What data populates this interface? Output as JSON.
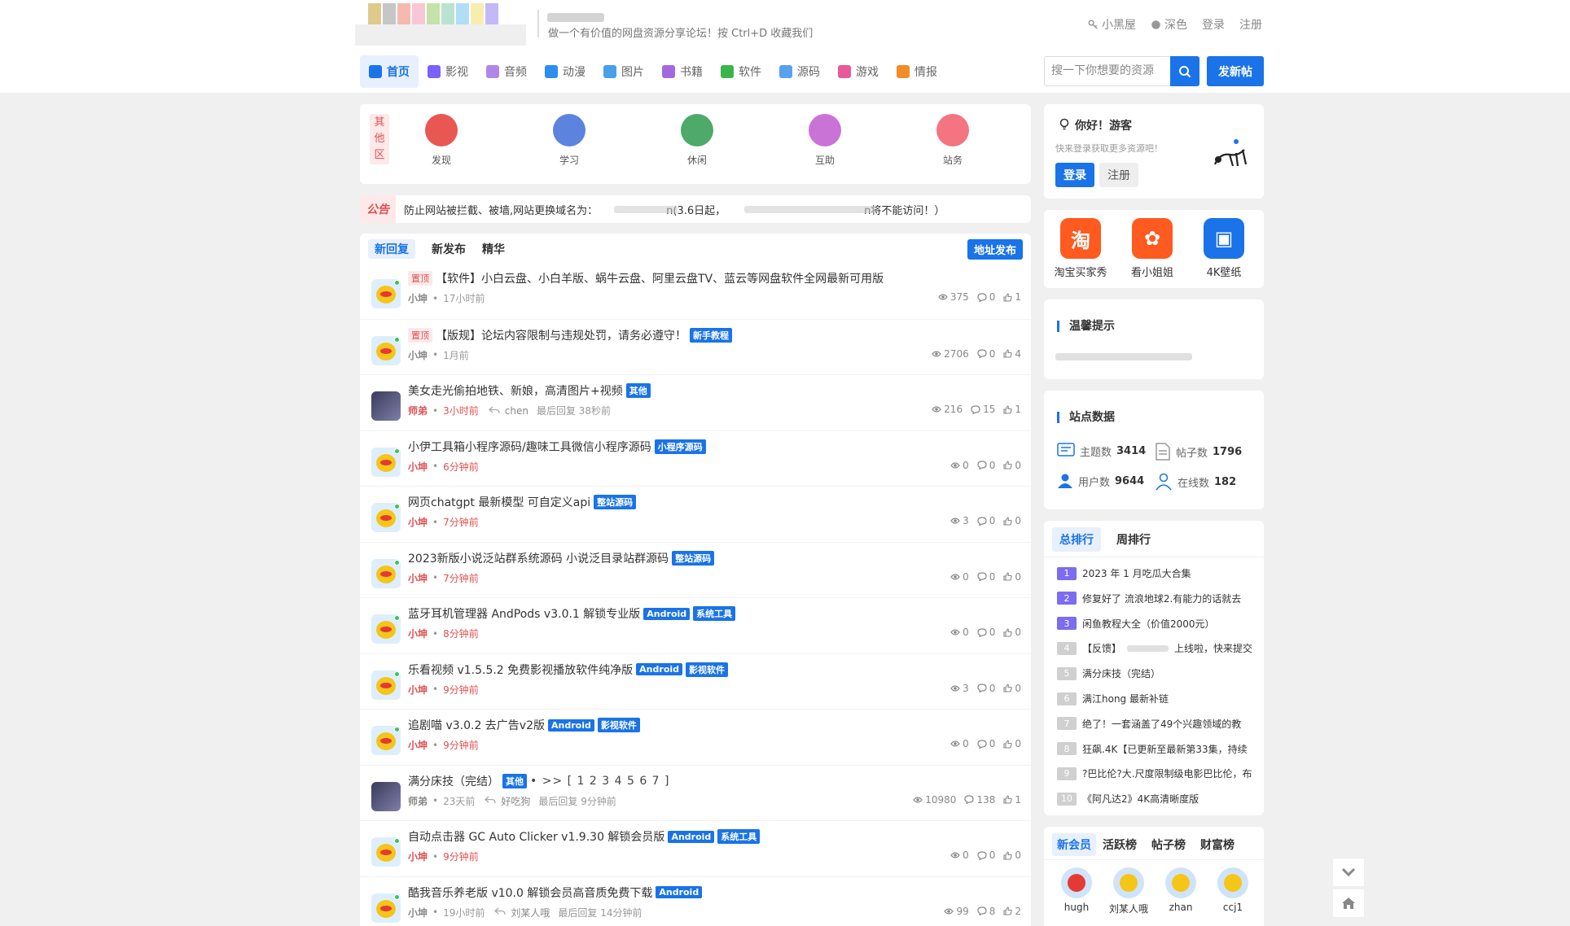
{
  "header": {
    "slogan": "做一个有价值的网盘资源分享论坛！按 Ctrl+D 收藏我们",
    "links": [
      "小黑屋",
      "深色",
      "登录",
      "注册"
    ],
    "search_placeholder": "搜一下你想要的资源",
    "post_button": "发新帖"
  },
  "nav": [
    {
      "label": "首页",
      "active": true,
      "color": "#1a73e8"
    },
    {
      "label": "影视",
      "color": "#7b61ff"
    },
    {
      "label": "音频",
      "color": "#b087e8"
    },
    {
      "label": "动漫",
      "color": "#2f8cf0"
    },
    {
      "label": "图片",
      "color": "#4aa0e8"
    },
    {
      "label": "书籍",
      "color": "#a36ae0"
    },
    {
      "label": "软件",
      "color": "#3bb54a"
    },
    {
      "label": "源码",
      "color": "#5aa0f0"
    },
    {
      "label": "游戏",
      "color": "#e85a9a"
    },
    {
      "label": "情报",
      "color": "#f28c28"
    }
  ],
  "categories": {
    "side_label": "其他区",
    "items": [
      {
        "label": "发现",
        "color": "#e53935"
      },
      {
        "label": "学习",
        "color": "#3f6fd8"
      },
      {
        "label": "休闲",
        "color": "#2e9b4f"
      },
      {
        "label": "互助",
        "color": "#c05ad0"
      },
      {
        "label": "站务",
        "color": "#f25c6c"
      }
    ]
  },
  "announcement": {
    "label": "公告",
    "text_a": "防止网站被拦截、被墙,网站更换域名为：",
    "text_b": "n(3.6日起，",
    "text_c": "n将不能访问！）"
  },
  "tabs": {
    "items": [
      "新回复",
      "新发布",
      "精华"
    ],
    "address_button": "地址发布"
  },
  "threads": [
    {
      "pin": "置顶",
      "title": "【软件】小白云盘、小白羊版、蜗牛云盘、阿里云盘TV、蓝云等网盘软件全网最新可用版",
      "tags": [],
      "author": "小坤",
      "time": "17小时前",
      "views": "375",
      "replies": "0",
      "likes": "1",
      "avatar": "kun"
    },
    {
      "pin": "置顶",
      "title": "【版规】论坛内容限制与违规处罚，请务必遵守！",
      "tags": [
        "新手教程"
      ],
      "author": "小坤",
      "time": "1月前",
      "views": "2706",
      "replies": "0",
      "likes": "4",
      "avatar": "kun"
    },
    {
      "title": "美女走光偷拍地铁、新娘，高清图片+视频",
      "tags": [
        "其他"
      ],
      "author": "师弟",
      "author_red": true,
      "time": "3小时前",
      "time_red": true,
      "reply_by": "chen",
      "last_reply": "最后回复 38秒前",
      "views": "216",
      "replies": "15",
      "likes": "1",
      "avatar": "girl"
    },
    {
      "title": "小伊工具箱小程序源码/趣味工具微信小程序源码",
      "tags": [
        "小程序源码"
      ],
      "author": "小坤",
      "author_red": true,
      "time": "6分钟前",
      "time_red": true,
      "views": "0",
      "replies": "0",
      "likes": "0",
      "avatar": "kun"
    },
    {
      "title": "网页chatgpt 最新模型 可自定义api",
      "tags": [
        "整站源码"
      ],
      "author": "小坤",
      "author_red": true,
      "time": "7分钟前",
      "time_red": true,
      "views": "3",
      "replies": "0",
      "likes": "0",
      "avatar": "kun"
    },
    {
      "title": "2023新版小说泛站群系统源码 小说泛目录站群源码",
      "tags": [
        "整站源码"
      ],
      "author": "小坤",
      "author_red": true,
      "time": "7分钟前",
      "time_red": true,
      "views": "0",
      "replies": "0",
      "likes": "0",
      "avatar": "kun"
    },
    {
      "title": "蓝牙耳机管理器 AndPods v3.0.1 解锁专业版",
      "tags": [
        "Android",
        "系统工具"
      ],
      "author": "小坤",
      "author_red": true,
      "time": "8分钟前",
      "time_red": true,
      "views": "0",
      "replies": "0",
      "likes": "0",
      "avatar": "kun"
    },
    {
      "title": "乐看视频 v1.5.5.2 免费影视播放软件纯净版",
      "tags": [
        "Android",
        "影视软件"
      ],
      "author": "小坤",
      "author_red": true,
      "time": "9分钟前",
      "time_red": true,
      "views": "3",
      "replies": "0",
      "likes": "0",
      "avatar": "kun"
    },
    {
      "title": "追剧喵 v3.0.2 去广告v2版",
      "tags": [
        "Android",
        "影视软件"
      ],
      "author": "小坤",
      "author_red": true,
      "time": "9分钟前",
      "time_red": true,
      "views": "0",
      "replies": "0",
      "likes": "0",
      "avatar": "kun"
    },
    {
      "title": "满分床技（完结）",
      "tags": [
        "其他"
      ],
      "pages": "• >> [ 1 2 3 4 5 6 7 ]",
      "author": "师弟",
      "time": "23天前",
      "reply_by": "好吃狗",
      "last_reply": "最后回复 9分钟前",
      "views": "10980",
      "replies": "138",
      "likes": "1",
      "avatar": "girl"
    },
    {
      "title": "自动点击器 GC Auto Clicker v1.9.30 解锁会员版",
      "tags": [
        "Android",
        "系统工具"
      ],
      "author": "小坤",
      "author_red": true,
      "time": "9分钟前",
      "time_red": true,
      "views": "0",
      "replies": "0",
      "likes": "0",
      "avatar": "kun"
    },
    {
      "title": "酷我音乐养老版 v10.0 解锁会员高音质免费下载",
      "tags": [
        "Android"
      ],
      "author": "小坤",
      "time": "19小时前",
      "reply_by": "刘某人哦",
      "last_reply": "最后回复 14分钟前",
      "views": "99",
      "replies": "8",
      "likes": "2",
      "avatar": "kun"
    }
  ],
  "sidebar": {
    "welcome": {
      "title": "你好！游客",
      "subtitle": "快来登录获取更多资源吧！",
      "login": "登录",
      "register": "注册"
    },
    "apps": [
      {
        "label": "淘宝买家秀",
        "glyph": "淘",
        "color": "#ff5a1f"
      },
      {
        "label": "看小姐姐",
        "glyph": "✿",
        "color": "#ff5a1f"
      },
      {
        "label": "4K壁纸",
        "glyph": "▣",
        "color": "#1a73e8"
      }
    ],
    "tips_title": "温馨提示",
    "site_stats": {
      "title": "站点数据",
      "items": [
        {
          "label": "主题数",
          "value": "3414"
        },
        {
          "label": "帖子数",
          "value": "1796"
        },
        {
          "label": "用户数",
          "value": "9644"
        },
        {
          "label": "在线数",
          "value": "182"
        }
      ]
    },
    "rank_tabs": [
      "总排行",
      "周排行"
    ],
    "ranks": [
      {
        "n": "1",
        "text": "2023 年 1 月吃瓜大合集",
        "color": "#7b6cf0"
      },
      {
        "n": "2",
        "text": "修复好了 流浪地球2.有能力的话就去",
        "color": "#7b6cf0"
      },
      {
        "n": "3",
        "text": "闲鱼教程大全（价值2000元）",
        "color": "#7b6cf0"
      },
      {
        "n": "4",
        "text": "【反馈】",
        "text_b": "上线啦，快来提交",
        "color": "#d0d0d0"
      },
      {
        "n": "5",
        "text": "满分床技（完结）",
        "color": "#d0d0d0"
      },
      {
        "n": "6",
        "text": "满江hong 最新补链",
        "color": "#d0d0d0"
      },
      {
        "n": "7",
        "text": "绝了！一套涵盖了49个兴趣领域的教",
        "color": "#d0d0d0"
      },
      {
        "n": "8",
        "text": "狂飙.4K【已更新至最新第33集，持续",
        "color": "#d0d0d0"
      },
      {
        "n": "9",
        "text": "?巴比伦?大.尺度限制级电影巴比伦，布",
        "color": "#d0d0d0"
      },
      {
        "n": "10",
        "text": "《阿凡达2》4K高清晰度版",
        "color": "#d0d0d0"
      }
    ],
    "member_tabs": [
      "新会员",
      "活跃榜",
      "帖子榜",
      "财富榜"
    ],
    "members": [
      "hugh",
      "刘某人哦",
      "zhan",
      "ccj1"
    ]
  }
}
